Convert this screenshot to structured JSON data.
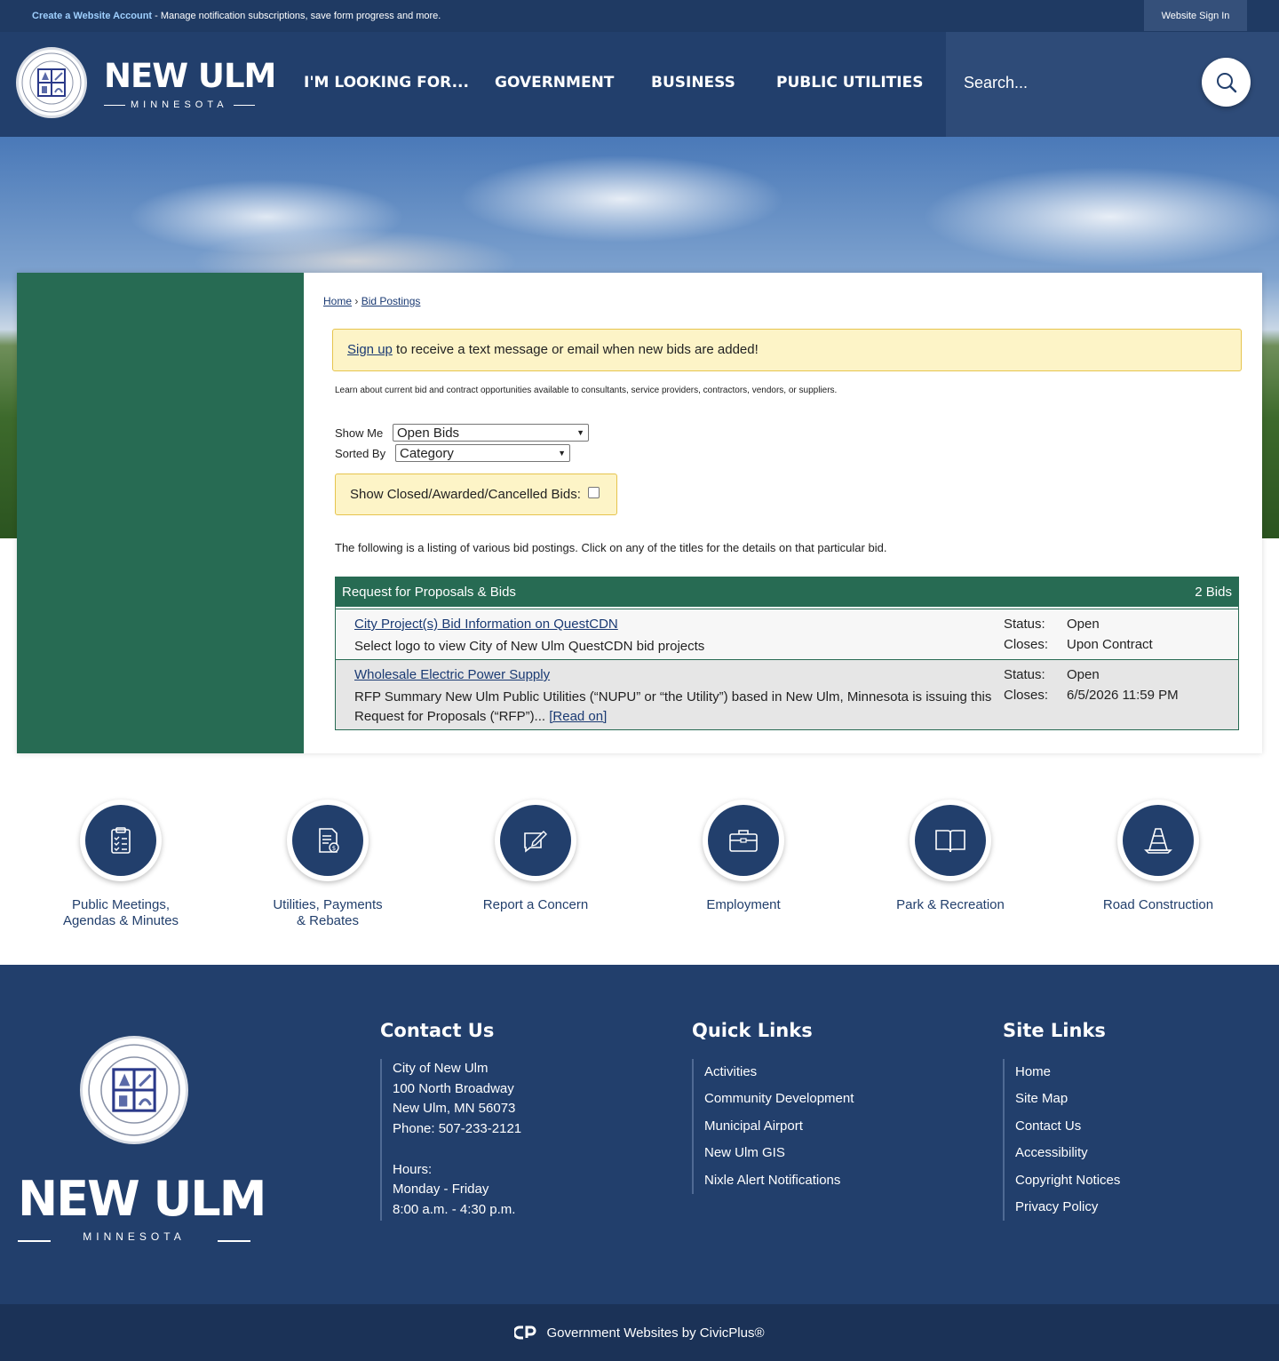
{
  "topbar": {
    "create_link": "Create a Website Account",
    "notice": " - Manage notification subscriptions, save form progress and more.",
    "signin": "Website Sign In"
  },
  "header": {
    "logo_big": "NEW ULM",
    "logo_small": "MINNESOTA",
    "nav": [
      "I'M LOOKING FOR...",
      "GOVERNMENT",
      "BUSINESS",
      "PUBLIC UTILITIES"
    ],
    "search_placeholder": "Search..."
  },
  "breadcrumb": {
    "home": "Home",
    "sep": "›",
    "current": "Bid Postings"
  },
  "alert": {
    "link": "Sign up",
    "text": " to receive a text message or email when new bids are added!"
  },
  "intro": "Learn about current bid and contract opportunities available to consultants, service providers, contractors, vendors, or suppliers.",
  "filters": {
    "show_me_label": "Show Me",
    "show_me_value": "Open Bids",
    "sorted_by_label": "Sorted By",
    "sorted_by_value": "Category",
    "closed_label": "Show Closed/Awarded/Cancelled Bids:",
    "closed_checked": false
  },
  "listing_note": "The following is a listing of various bid postings. Click on any of the titles for the details on that particular bid.",
  "bids": {
    "category": "Request for Proposals & Bids",
    "count": "2 Bids",
    "items": [
      {
        "title": "City Project(s) Bid Information on QuestCDN",
        "desc": "Select logo to view City of New Ulm QuestCDN bid projects",
        "status_label": "Status:",
        "status": "Open",
        "closes_label": "Closes:",
        "closes": "Upon Contract"
      },
      {
        "title": "Wholesale Electric Power Supply",
        "desc": "RFP Summary New Ulm Public Utilities (“NUPU” or “the Utility”) based in New Ulm, Minnesota is issuing this Request for Proposals (“RFP”)... ",
        "read_on": "[Read on]",
        "status_label": "Status:",
        "status": "Open",
        "closes_label": "Closes:",
        "closes": "6/5/2026 11:59 PM"
      }
    ]
  },
  "quick_links": [
    {
      "line1": "Public Meetings,",
      "line2": "Agendas & Minutes",
      "icon": "clipboard-icon"
    },
    {
      "line1": "Utilities, Payments",
      "line2": "& Rebates",
      "icon": "bill-icon"
    },
    {
      "line1": "Report a Concern",
      "line2": "",
      "icon": "edit-icon"
    },
    {
      "line1": "Employment",
      "line2": "",
      "icon": "briefcase-icon"
    },
    {
      "line1": "Park & Recreation",
      "line2": "",
      "icon": "book-icon"
    },
    {
      "line1": "Road Construction",
      "line2": "",
      "icon": "cone-icon"
    }
  ],
  "footer": {
    "logo_big": "NEW ULM",
    "logo_small": "MINNESOTA",
    "contact": {
      "heading": "Contact Us",
      "lines": [
        "City of New Ulm",
        "100 North Broadway",
        "New Ulm, MN 56073",
        "Phone: 507-233-2121",
        "",
        "Hours:",
        "Monday - Friday",
        "8:00 a.m. - 4:30 p.m."
      ]
    },
    "quick": {
      "heading": "Quick Links",
      "links": [
        "Activities",
        "Community Development",
        "Municipal Airport",
        "New Ulm GIS",
        "Nixle Alert Notifications"
      ]
    },
    "site": {
      "heading": "Site Links",
      "links": [
        "Home",
        "Site Map",
        "Contact Us",
        "Accessibility",
        "Copyright Notices",
        "Privacy Policy"
      ]
    },
    "credit": "Government Websites by CivicPlus®"
  },
  "colors": {
    "navy": "#223f6c",
    "green": "#276b53",
    "alert_bg": "#fdf4c7"
  }
}
